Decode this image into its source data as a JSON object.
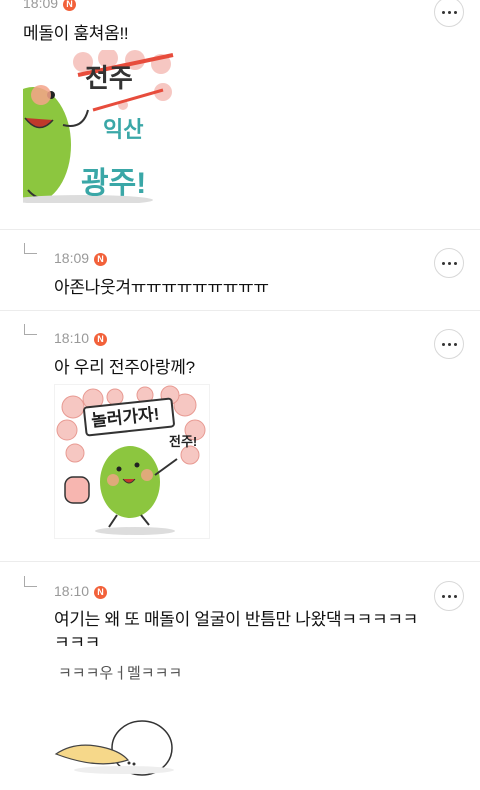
{
  "comments": [
    {
      "time": "18:09",
      "badge": "N",
      "text": "메돌이 훔쳐옴!!",
      "sticker_text": [
        "전주",
        "익산",
        "광주!"
      ]
    },
    {
      "time": "18:09",
      "badge": "N",
      "text": "아존나웃겨ㅠㅠㅠㅠㅠㅠㅠㅠㅠ"
    },
    {
      "time": "18:10",
      "badge": "N",
      "text": "아 우리 전주아랑께?",
      "sticker_text": [
        "놀러가자!",
        "전주!"
      ]
    },
    {
      "time": "18:10",
      "badge": "N",
      "text_line1": "여기는 왜 또 매돌이 얼굴이 반틈만 나왔댁ㅋㅋㅋㅋㅋ",
      "text_line2": "ㅋㅋㅋ",
      "sticker_text": [
        "ㅋㅋㅋ우ㅓ멜ㅋㅋㅋ"
      ]
    }
  ]
}
